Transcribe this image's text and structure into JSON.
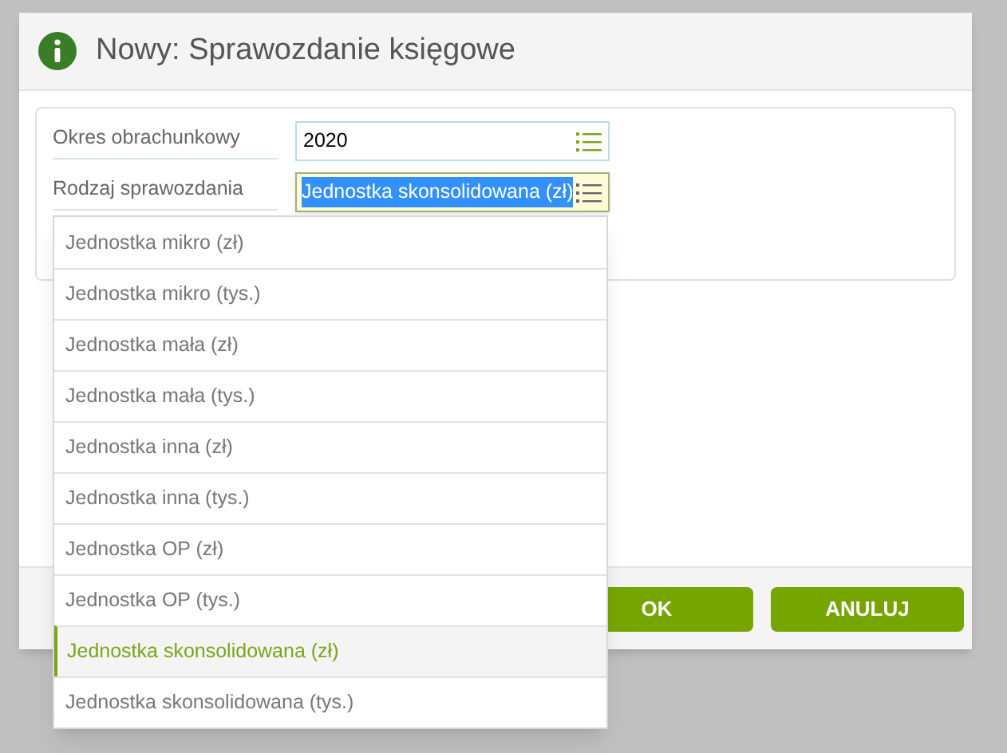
{
  "window": {
    "title": "Nowy: Sprawozdanie księgowe"
  },
  "fields": [
    {
      "label": "Okres obrachunkowy",
      "value": "2020",
      "focused": false
    },
    {
      "label": "Rodzaj sprawozdania",
      "value": "Jednostka skonsolidowana (zł)",
      "focused": true
    }
  ],
  "dropdown": {
    "options": [
      {
        "label": "Jednostka mikro (zł)",
        "selected": false
      },
      {
        "label": "Jednostka mikro (tys.)",
        "selected": false
      },
      {
        "label": "Jednostka mała (zł)",
        "selected": false
      },
      {
        "label": "Jednostka mała (tys.)",
        "selected": false
      },
      {
        "label": "Jednostka inna (zł)",
        "selected": false
      },
      {
        "label": "Jednostka inna (tys.)",
        "selected": false
      },
      {
        "label": "Jednostka OP (zł)",
        "selected": false
      },
      {
        "label": "Jednostka OP (tys.)",
        "selected": false
      },
      {
        "label": "Jednostka skonsolidowana (zł)",
        "selected": true
      },
      {
        "label": "Jednostka skonsolidowana (tys.)",
        "selected": false
      }
    ]
  },
  "buttons": [
    "OK",
    "ANULUJ"
  ]
}
